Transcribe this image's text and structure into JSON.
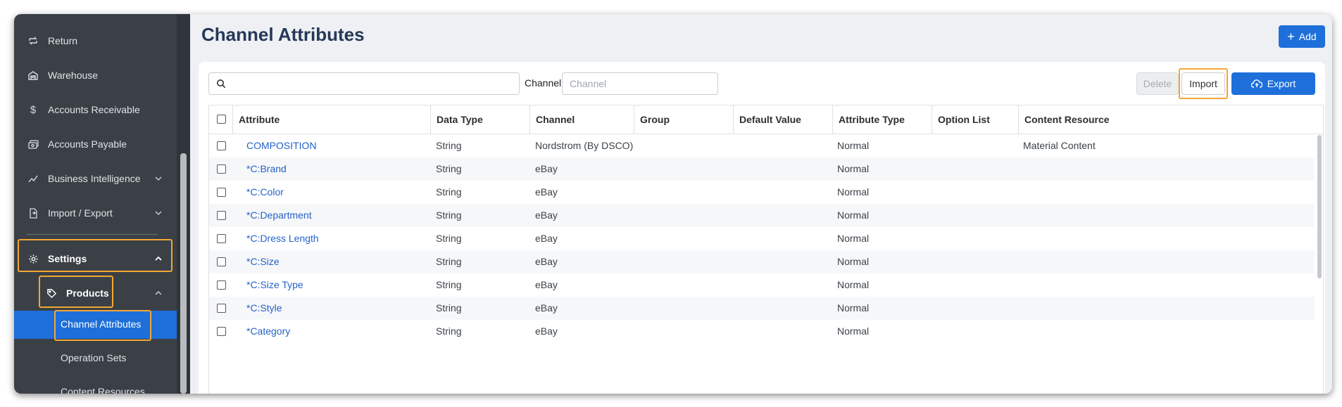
{
  "sidebar": {
    "items": [
      {
        "label": "Return",
        "icon": "return-icon"
      },
      {
        "label": "Warehouse",
        "icon": "warehouse-icon"
      },
      {
        "label": "Accounts Receivable",
        "icon": "dollar-icon"
      },
      {
        "label": "Accounts Payable",
        "icon": "money-icon"
      },
      {
        "label": "Business Intelligence",
        "icon": "chart-line-icon"
      },
      {
        "label": "Import / Export",
        "icon": "import-export-icon"
      }
    ],
    "settings": {
      "label": "Settings",
      "icon": "gear-icon"
    },
    "products": {
      "label": "Products",
      "icon": "tag-icon"
    },
    "sub_items": [
      {
        "label": "Channel Attributes"
      },
      {
        "label": "Operation Sets"
      },
      {
        "label": "Content Resources"
      }
    ]
  },
  "header": {
    "title": "Channel Attributes",
    "add_label": "Add"
  },
  "toolbar": {
    "search_value": "",
    "channel_label": "Channel",
    "channel_placeholder": "Channel",
    "delete_label": "Delete",
    "import_label": "Import",
    "export_label": "Export"
  },
  "table": {
    "columns": [
      "Attribute",
      "Data Type",
      "Channel",
      "Group",
      "Default Value",
      "Attribute Type",
      "Option List",
      "Content Resource"
    ],
    "rows": [
      {
        "attribute": "COMPOSITION",
        "data_type": "String",
        "channel": "Nordstrom (By DSCO)",
        "group": "",
        "default_value": "",
        "attribute_type": "Normal",
        "option_list": "",
        "content_resource": "Material Content"
      },
      {
        "attribute": "*C:Brand",
        "data_type": "String",
        "channel": "eBay",
        "group": "",
        "default_value": "",
        "attribute_type": "Normal",
        "option_list": "",
        "content_resource": ""
      },
      {
        "attribute": "*C:Color",
        "data_type": "String",
        "channel": "eBay",
        "group": "",
        "default_value": "",
        "attribute_type": "Normal",
        "option_list": "",
        "content_resource": ""
      },
      {
        "attribute": "*C:Department",
        "data_type": "String",
        "channel": "eBay",
        "group": "",
        "default_value": "",
        "attribute_type": "Normal",
        "option_list": "",
        "content_resource": ""
      },
      {
        "attribute": "*C:Dress Length",
        "data_type": "String",
        "channel": "eBay",
        "group": "",
        "default_value": "",
        "attribute_type": "Normal",
        "option_list": "",
        "content_resource": ""
      },
      {
        "attribute": "*C:Size",
        "data_type": "String",
        "channel": "eBay",
        "group": "",
        "default_value": "",
        "attribute_type": "Normal",
        "option_list": "",
        "content_resource": ""
      },
      {
        "attribute": "*C:Size Type",
        "data_type": "String",
        "channel": "eBay",
        "group": "",
        "default_value": "",
        "attribute_type": "Normal",
        "option_list": "",
        "content_resource": ""
      },
      {
        "attribute": "*C:Style",
        "data_type": "String",
        "channel": "eBay",
        "group": "",
        "default_value": "",
        "attribute_type": "Normal",
        "option_list": "",
        "content_resource": ""
      },
      {
        "attribute": "*Category",
        "data_type": "String",
        "channel": "eBay",
        "group": "",
        "default_value": "",
        "attribute_type": "Normal",
        "option_list": "",
        "content_resource": ""
      }
    ]
  },
  "colors": {
    "accent": "#1e6fd9",
    "highlight": "#f4a733",
    "sidebar_bg": "#3a4046",
    "link": "#2563c9"
  }
}
